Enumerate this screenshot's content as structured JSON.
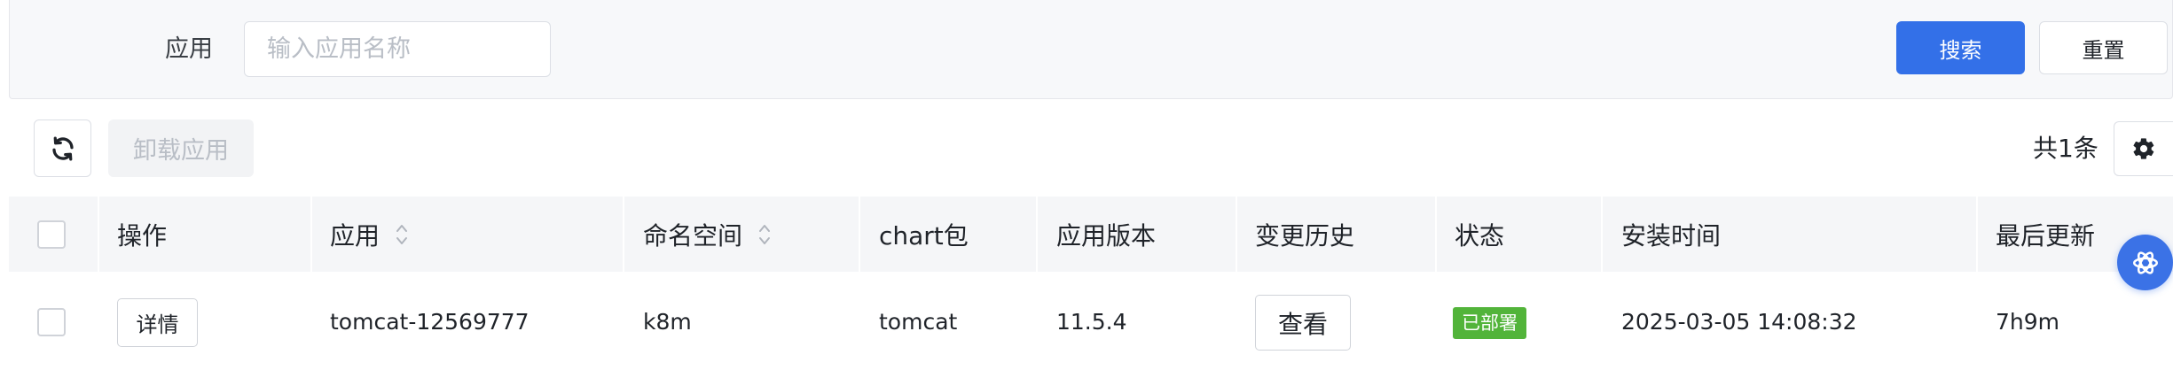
{
  "search": {
    "label": "应用",
    "placeholder": "输入应用名称",
    "value": "",
    "search_button": "搜索",
    "reset_button": "重置"
  },
  "toolbar": {
    "refresh_icon": "refresh-icon",
    "uninstall_button": "卸载应用",
    "total": "共1条",
    "settings_icon": "gear-icon"
  },
  "table": {
    "columns": [
      "操作",
      "应用",
      "命名空间",
      "chart包",
      "应用版本",
      "变更历史",
      "状态",
      "安装时间",
      "最后更新"
    ],
    "rows": [
      {
        "action": "详情",
        "app": "tomcat-12569777",
        "namespace": "k8m",
        "chart": "tomcat",
        "version": "11.5.4",
        "history": "查看",
        "status": "已部署",
        "install_time": "2025-03-05 14:08:32",
        "last_update": "7h9m"
      }
    ]
  },
  "colors": {
    "primary": "#3370e8",
    "status_success": "#52b43a",
    "header_bg": "#f5f6f8"
  },
  "floating_button_icon": "ai-assistant-icon"
}
